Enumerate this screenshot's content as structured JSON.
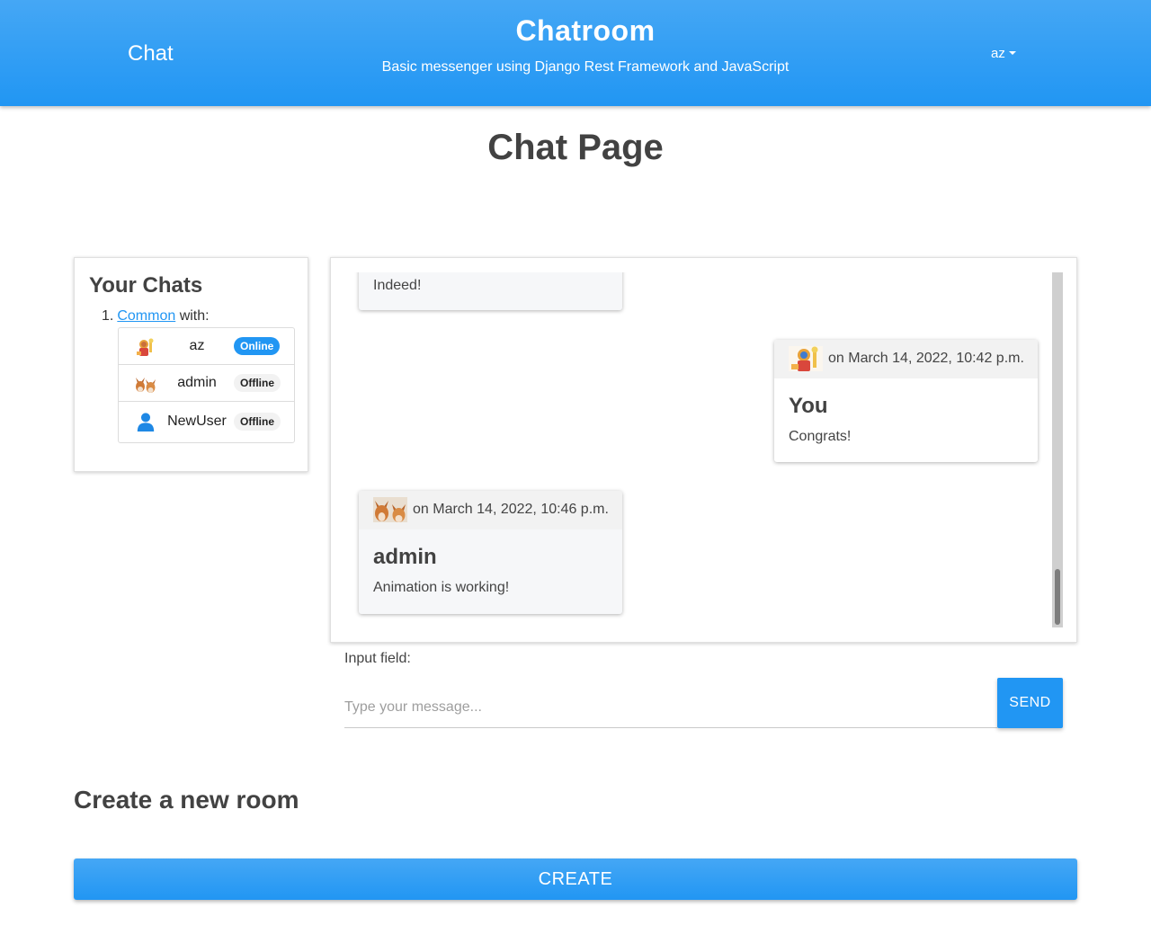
{
  "header": {
    "brand": "Chat",
    "title": "Chatroom",
    "subtitle": "Basic messenger using Django Rest Framework and JavaScript",
    "user_menu": "az"
  },
  "page_title": "Chat Page",
  "chats_panel": {
    "heading": "Your Chats",
    "items": [
      {
        "number": "1.",
        "room_link": "Common",
        "with_text": " with:",
        "members": [
          {
            "name": "az",
            "status": "Online",
            "avatar": "deity-avatar"
          },
          {
            "name": "admin",
            "status": "Offline",
            "avatar": "foxes-avatar"
          },
          {
            "name": "NewUser",
            "status": "Offline",
            "avatar": "default-user-icon"
          }
        ]
      }
    ]
  },
  "messages": [
    {
      "author": "",
      "time": "",
      "text": "Indeed!",
      "mine": false
    },
    {
      "author": "You",
      "time": "on March 14, 2022, 10:42 p.m.",
      "text": "Congrats!",
      "mine": true,
      "avatar": "deity-avatar"
    },
    {
      "author": "admin",
      "time": "on March 14, 2022, 10:46 p.m.",
      "text": "Animation is working!",
      "mine": false,
      "avatar": "foxes-avatar"
    }
  ],
  "composer": {
    "label": "Input field:",
    "placeholder": "Type your message...",
    "value": "",
    "send_label": "SEND"
  },
  "create_room": {
    "heading": "Create a new room",
    "button_label": "CREATE"
  },
  "colors": {
    "primary": "#2196f3",
    "header_top": "#45a7f5",
    "online_badge": "#2196f3",
    "offline_badge": "#f2f2f2"
  }
}
